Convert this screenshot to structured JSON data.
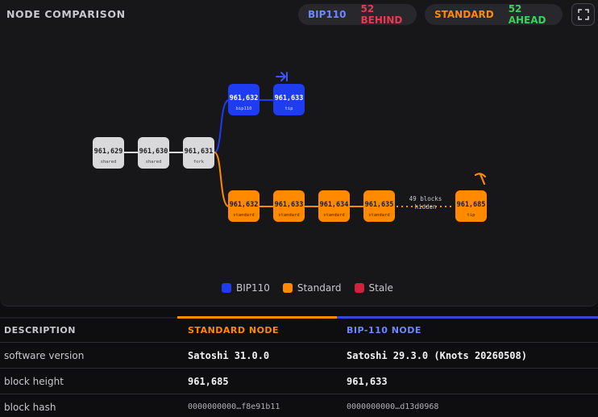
{
  "header": {
    "title": "NODE COMPARISON",
    "bip_pill": {
      "name": "BIP110",
      "status": "52 BEHIND"
    },
    "std_pill": {
      "name": "STANDARD",
      "status": "52 AHEAD"
    }
  },
  "colors": {
    "bip": "#1e3cf0",
    "standard": "#ff8a00",
    "stale": "#d0223f",
    "shared": "#d9d9dc"
  },
  "graph": {
    "shared_blocks": [
      {
        "num": "961,629",
        "label": "shared"
      },
      {
        "num": "961,630",
        "label": "shared"
      },
      {
        "num": "961,631",
        "label": "fork"
      }
    ],
    "bip_blocks": [
      {
        "num": "961,632",
        "label": "bip110"
      },
      {
        "num": "961,633",
        "label": "tip"
      }
    ],
    "standard_blocks": [
      {
        "num": "961,632",
        "label": "standard"
      },
      {
        "num": "961,633",
        "label": "standard"
      },
      {
        "num": "961,634",
        "label": "standard"
      },
      {
        "num": "961,635",
        "label": "standard"
      }
    ],
    "hidden": {
      "line1": "49 blocks",
      "line2": "hidden"
    },
    "standard_tip": {
      "num": "961,685",
      "label": "tip"
    }
  },
  "legend": [
    {
      "label": "BIP110",
      "color": "#1e3cf0"
    },
    {
      "label": "Standard",
      "color": "#ff8a00"
    },
    {
      "label": "Stale",
      "color": "#d0223f"
    }
  ],
  "table": {
    "headers": {
      "description": "DESCRIPTION",
      "standard": "STANDARD NODE",
      "bip": "BIP-110 NODE"
    },
    "rows": [
      {
        "desc": "software version",
        "standard": "Satoshi 31.0.0",
        "bip": "Satoshi 29.3.0 (Knots 20260508)"
      },
      {
        "desc": "block height",
        "standard": "961,685",
        "bip": "961,633"
      },
      {
        "desc": "block hash",
        "standard": "0000000000…f8e91b11",
        "bip": "0000000000…d13d0968"
      }
    ]
  }
}
